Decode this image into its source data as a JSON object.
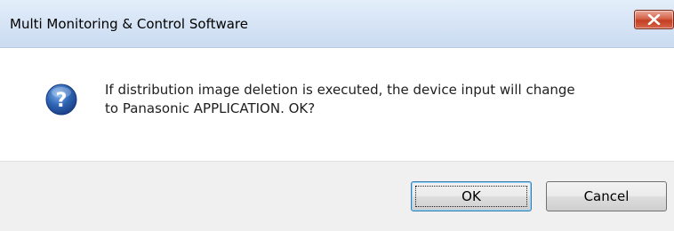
{
  "window": {
    "title": "Multi Monitoring & Control Software",
    "close_icon": "close-icon"
  },
  "message": {
    "icon": "question-icon",
    "line1": "If distribution image deletion is executed, the device input will change",
    "line2": "to Panasonic APPLICATION. OK?"
  },
  "buttons": {
    "ok_label": "OK",
    "cancel_label": "Cancel"
  },
  "colors": {
    "close_button": "#c23e22",
    "question_icon": "#2f64b3",
    "default_button_border": "#3c7fb1"
  }
}
